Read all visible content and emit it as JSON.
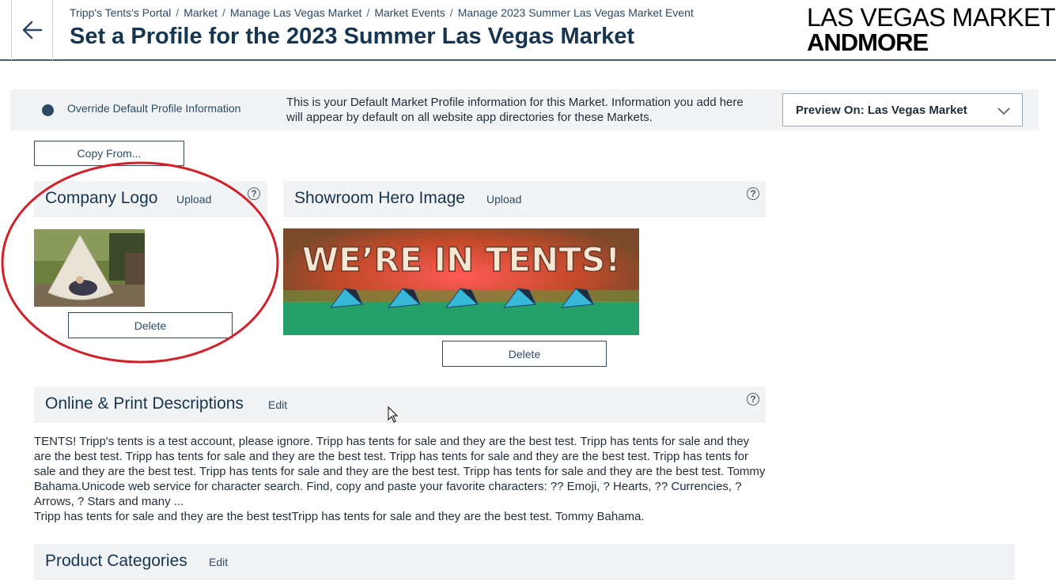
{
  "header": {
    "breadcrumbs": [
      "Tripp's Tents's Portal",
      "Market",
      "Manage Las Vegas Market",
      "Market Events",
      "Manage 2023 Summer Las Vegas Market Event"
    ],
    "title": "Set a Profile for the 2023 Summer Las Vegas Market",
    "brand_line1": "LAS VEGAS MARKET",
    "brand_line2": "ANDMORE"
  },
  "override": {
    "label": "Override Default Profile Information",
    "note": "This is your Default Market Profile information for this Market. Information you add here will appear by default on all website app directories for these Markets.",
    "preview_label": "Preview On: Las Vegas Market"
  },
  "copy_from_label": "Copy From...",
  "company_logo": {
    "title": "Company Logo",
    "upload_label": "Upload",
    "delete_label": "Delete"
  },
  "hero_image": {
    "title": "Showroom Hero Image",
    "upload_label": "Upload",
    "banner_text": "WE’RE IN TENTS!",
    "delete_label": "Delete"
  },
  "descriptions": {
    "title": "Online & Print Descriptions",
    "edit_label": "Edit",
    "paragraph1": "TENTS! Tripp's tents is a test account, please ignore. Tripp has tents for sale and they are the best test. Tripp has tents for sale and they are the best test. Tripp has tents for sale and they are the best test. Tripp has tents for sale and they are the best test. Tripp has tents for sale and they are the best test. Tripp has tents for sale and they are the best test. Tripp has tents for sale and they are the best test. Tommy Bahama.Unicode web service for character search. Find, copy and paste your favorite characters: ?? Emoji, ? Hearts, ?? Currencies, ? Arrows, ? Stars and many ...",
    "paragraph2": "Tripp has tents for sale and they are the best testTripp has tents for sale and they are the best test. Tommy Bahama."
  },
  "product_categories": {
    "title": "Product Categories",
    "edit_label": "Edit"
  },
  "help_glyph": "?",
  "colors": {
    "primary": "#163550",
    "link": "#2c4a66",
    "section_bg": "#f2f3f4",
    "annotation": "#d0202a"
  }
}
